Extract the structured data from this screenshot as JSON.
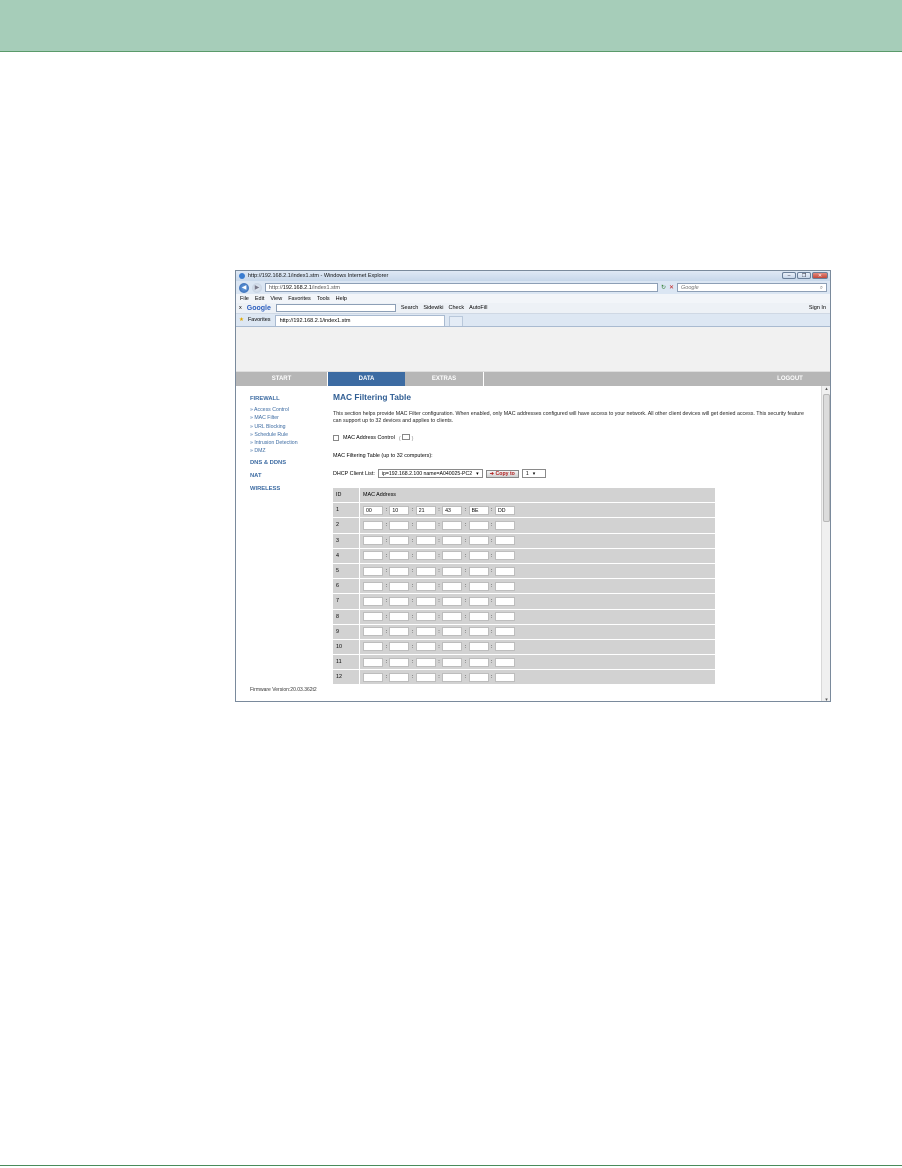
{
  "browser": {
    "title": "http://192.168.2.1/index1.stm - Windows Internet Explorer",
    "address_prefix": "http://",
    "address_host": "192.168.2.1",
    "address_path": "/index1.stm",
    "search_placeholder": "Google",
    "menu": [
      "File",
      "Edit",
      "View",
      "Favorites",
      "Tools",
      "Help"
    ],
    "toolbar": {
      "close": "x",
      "brand": "Google",
      "search": "Search",
      "sidewiki": "Sidewiki",
      "check": "Check",
      "autofill": "AutoFill",
      "signin": "Sign In"
    },
    "favorites_label": "Favorites",
    "tab_label": "http://192.168.2.1/index1.stm"
  },
  "nav": {
    "start": "START",
    "data": "DATA",
    "extras": "EXTRAS",
    "logout": "LOGOUT"
  },
  "sidebar": {
    "firewall": "FIREWALL",
    "items": [
      "» Access Control",
      "» MAC Filter",
      "» URL Blocking",
      "» Schedule Rule",
      "» Intrusion Detection",
      "» DMZ"
    ],
    "dns": "DNS & DDNS",
    "nat": "NAT",
    "wireless": "WIRELESS",
    "firmware": "Firmware Version:20.03.362t2"
  },
  "main": {
    "title": "MAC Filtering Table",
    "description": "This section helps provide MAC Filter configuration. When enabled, only MAC addresses configured will have access to your network. All other client devices will get denied access. This security feature can support up to 32 devices and applies to clients.",
    "mac_control_label": "MAC Address Control",
    "table_caption": "MAC Filtering Table (up to 32 computers):",
    "dhcp_label": "DHCP Client List:",
    "dhcp_selected": "ip=192.168.2.100 name=A040025-PC2",
    "copy_button": "Copy to",
    "copy_target": "1",
    "col_id": "ID",
    "col_mac": "MAC Address",
    "rows": [
      {
        "id": "1",
        "octets": [
          "00",
          "10",
          "21",
          "43",
          "BE",
          "DD"
        ]
      },
      {
        "id": "2",
        "octets": [
          "",
          "",
          "",
          "",
          "",
          ""
        ]
      },
      {
        "id": "3",
        "octets": [
          "",
          "",
          "",
          "",
          "",
          ""
        ]
      },
      {
        "id": "4",
        "octets": [
          "",
          "",
          "",
          "",
          "",
          ""
        ]
      },
      {
        "id": "5",
        "octets": [
          "",
          "",
          "",
          "",
          "",
          ""
        ]
      },
      {
        "id": "6",
        "octets": [
          "",
          "",
          "",
          "",
          "",
          ""
        ]
      },
      {
        "id": "7",
        "octets": [
          "",
          "",
          "",
          "",
          "",
          ""
        ]
      },
      {
        "id": "8",
        "octets": [
          "",
          "",
          "",
          "",
          "",
          ""
        ]
      },
      {
        "id": "9",
        "octets": [
          "",
          "",
          "",
          "",
          "",
          ""
        ]
      },
      {
        "id": "10",
        "octets": [
          "",
          "",
          "",
          "",
          "",
          ""
        ]
      },
      {
        "id": "11",
        "octets": [
          "",
          "",
          "",
          "",
          "",
          ""
        ]
      },
      {
        "id": "12",
        "octets": [
          "",
          "",
          "",
          "",
          "",
          ""
        ]
      }
    ]
  },
  "colors": {
    "doc_header": "#a6cdb9",
    "nav_active": "#3c6ba2",
    "nav_inactive": "#b6b6b6",
    "link_blue": "#3c6ba2",
    "table_bg": "#d2d2d2"
  }
}
